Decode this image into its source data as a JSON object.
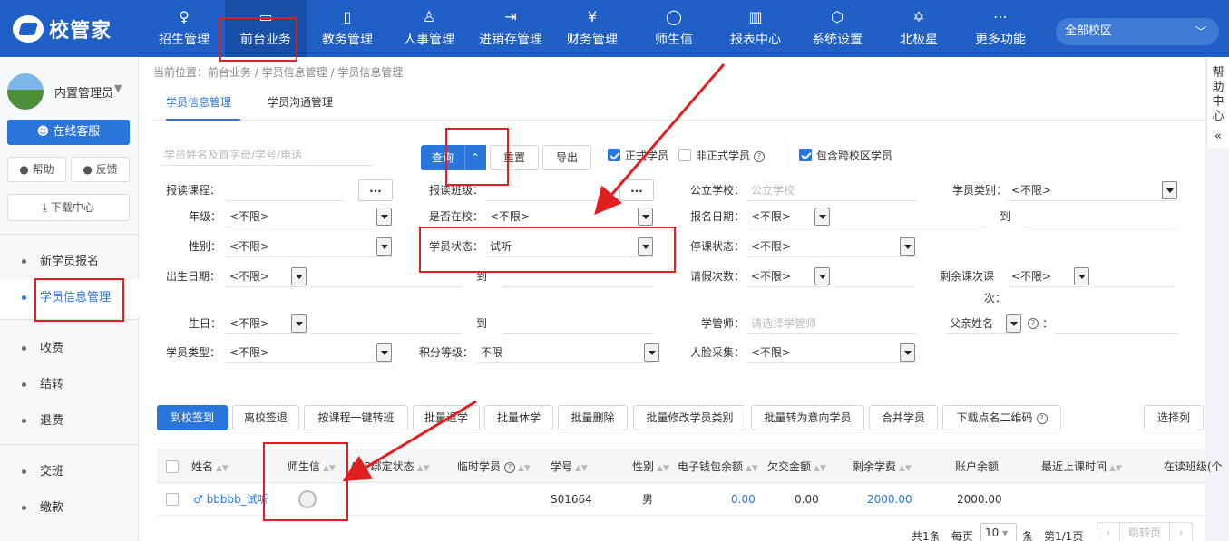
{
  "app": {
    "logo_text": "校管家"
  },
  "nav": [
    {
      "label": "招生管理",
      "icon": "person-add-icon",
      "glyph": "♀"
    },
    {
      "label": "前台业务",
      "icon": "monitor-icon",
      "glyph": "▭",
      "active": true
    },
    {
      "label": "教务管理",
      "icon": "book-icon",
      "glyph": "▯"
    },
    {
      "label": "人事管理",
      "icon": "user-icon",
      "glyph": "♙"
    },
    {
      "label": "进销存管理",
      "icon": "exchange-icon",
      "glyph": "⇥"
    },
    {
      "label": "财务管理",
      "icon": "money-shield-icon",
      "glyph": "¥"
    },
    {
      "label": "师生信",
      "icon": "chat-icon",
      "glyph": "◯"
    },
    {
      "label": "报表中心",
      "icon": "report-icon",
      "glyph": "▥"
    },
    {
      "label": "系统设置",
      "icon": "settings-icon",
      "glyph": "⬡"
    },
    {
      "label": "北极星",
      "icon": "star-icon",
      "glyph": "✡"
    },
    {
      "label": "更多功能",
      "icon": "more-icon",
      "glyph": "⋯"
    }
  ],
  "campus_select": {
    "value": "全部校区"
  },
  "sidebar": {
    "user_name": "内置管理员",
    "service_button": "在线客服",
    "help_button": "帮助",
    "feedback_button": "反馈",
    "download_button": "下载中心",
    "items": [
      {
        "label": "新学员报名"
      },
      {
        "label": "学员信息管理",
        "active": true
      },
      {
        "label": "收费"
      },
      {
        "label": "结转"
      },
      {
        "label": "退费"
      },
      {
        "label": "交班"
      },
      {
        "label": "缴款"
      }
    ]
  },
  "help_center": "帮助中心",
  "breadcrumb": "当前位置：前台业务 / 学员信息管理 / 学员信息管理",
  "tabs": [
    {
      "label": "学员信息管理",
      "active": true
    },
    {
      "label": "学员沟通管理"
    }
  ],
  "search": {
    "placeholder": "学员姓名及首字母/学号/电话",
    "query_button": "查询",
    "reset_button": "重置",
    "export_button": "导出",
    "checks": [
      {
        "label": "正式学员",
        "checked": true
      },
      {
        "label": "非正式学员",
        "checked": false
      },
      {
        "label": "包含跨校区学员",
        "checked": true
      }
    ]
  },
  "filters": {
    "course": {
      "label": "报读课程："
    },
    "class": {
      "label": "报读班级："
    },
    "public_school": {
      "label": "公立学校：",
      "placeholder": "公立学校"
    },
    "student_category": {
      "label": "学员类别：",
      "value": "<不限>"
    },
    "grade": {
      "label": "年级：",
      "value": "<不限>"
    },
    "in_school": {
      "label": "是否在校：",
      "value": "<不限>"
    },
    "enroll_date": {
      "label": "报名日期：",
      "value": "<不限>",
      "to": "到"
    },
    "gender": {
      "label": "性别：",
      "value": "<不限>"
    },
    "student_status": {
      "label": "学员状态：",
      "value": "试听"
    },
    "suspend_status": {
      "label": "停课状态：",
      "value": "<不限>"
    },
    "birth_date": {
      "label": "出生日期：",
      "value": "<不限>",
      "to": "到"
    },
    "leave_count": {
      "label": "请假次数：",
      "value": "<不限>"
    },
    "remaining_lessons": {
      "label": "剩余课次课次：",
      "label_a": "剩余课次课",
      "label_b": "次：",
      "value": "<不限>"
    },
    "birthday": {
      "label": "生日：",
      "value": "<不限>",
      "to": "到"
    },
    "manager": {
      "label": "学管师：",
      "placeholder": "请选择学管师"
    },
    "father_name": {
      "label": "父亲姓名",
      "colon": "："
    },
    "student_type": {
      "label": "学员类型：",
      "value": "<不限>"
    },
    "points_level": {
      "label": "积分等级：",
      "value": "不限"
    },
    "face_capture": {
      "label": "人脸采集：",
      "value": "<不限>"
    }
  },
  "actions": [
    "到校签到",
    "离校签退",
    "按课程一键转班",
    "批量退学",
    "批量休学",
    "批量删除",
    "批量修改学员类别",
    "批量转为意向学员",
    "合并学员",
    "下载点名二维码"
  ],
  "select_columns": "选择列",
  "table": {
    "columns": [
      "姓名",
      "师生信",
      "APP绑定状态",
      "临时学员",
      "学号",
      "性别",
      "电子钱包余额",
      "欠交金额",
      "剩余学费",
      "账户余额",
      "最近上课时间",
      "在读班级(个"
    ],
    "rows": [
      {
        "name": "bbbbb_试听",
        "gender_icon": "♂",
        "id": "S01664",
        "gender": "男",
        "wallet": "0.00",
        "owed": "0.00",
        "remaining_fee": "2000.00",
        "balance": "2000.00"
      }
    ]
  },
  "pager": {
    "total": "共1条",
    "per_page_label": "每页",
    "per_page": "10",
    "unit": "条",
    "page": "第1/1页",
    "jump": "跳转页"
  }
}
